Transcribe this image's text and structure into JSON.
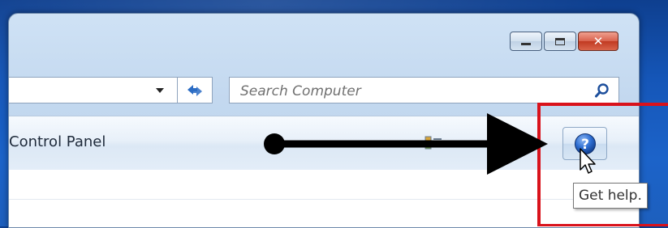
{
  "window": {
    "controls": {
      "minimize": "minimize-button",
      "maximize": "maximize-button",
      "close": "close-button"
    }
  },
  "address_bar": {
    "refresh_icon": "refresh-arrows-icon"
  },
  "search": {
    "placeholder": "Search Computer",
    "icon": "magnifier-icon"
  },
  "command_bar": {
    "label": "Control Panel",
    "help_icon": "help-question-icon"
  },
  "tooltip": {
    "text": "Get help."
  },
  "colors": {
    "highlight_box": "#d9121b",
    "arrow": "#000000",
    "help_blue": "#1f5fc4",
    "close_red": "#c13a22"
  }
}
